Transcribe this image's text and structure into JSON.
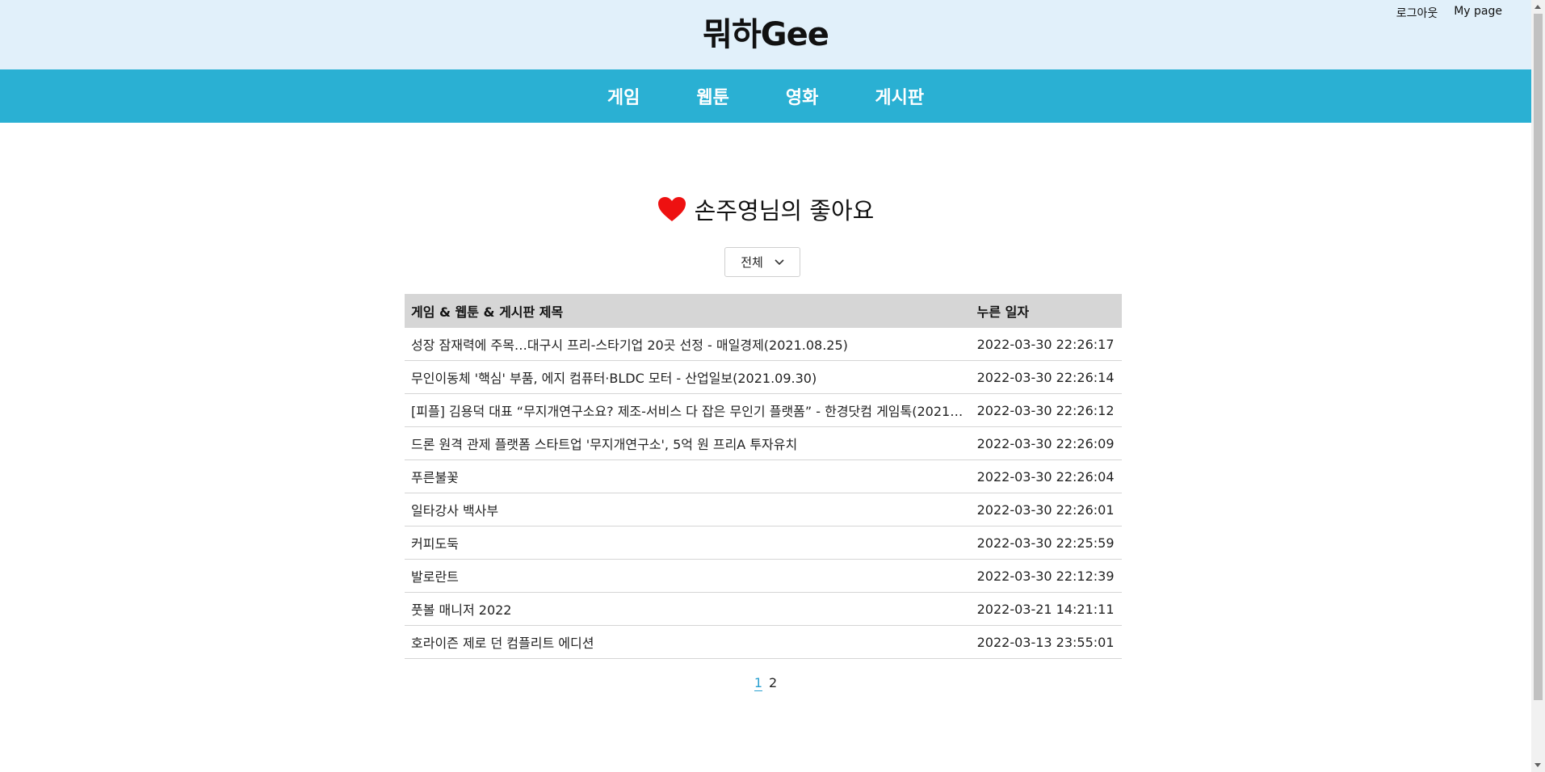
{
  "header": {
    "logo": "뭐하Gee",
    "logout_label": "로그아웃",
    "mypage_label": "My page"
  },
  "nav": {
    "items": [
      {
        "label": "게임"
      },
      {
        "label": "웹툰"
      },
      {
        "label": "영화"
      },
      {
        "label": "게시판"
      }
    ]
  },
  "main": {
    "title": "손주영님의 좋아요",
    "heart_color": "#ee1111",
    "filter": {
      "selected": "전체"
    },
    "table": {
      "headers": [
        "게임 & 웹툰 & 게시판 제목",
        "누른 일자"
      ],
      "rows": [
        {
          "title": "성장 잠재력에 주목…대구시 프리-스타기업 20곳 선정 - 매일경제(2021.08.25)",
          "date": "2022-03-30 22:26:17"
        },
        {
          "title": "무인이동체 '핵심' 부품, 에지 컴퓨터·BLDC 모터 - 산업일보(2021.09.30)",
          "date": "2022-03-30 22:26:14"
        },
        {
          "title": "[피플] 김용덕 대표 “무지개연구소요? 제조-서비스 다 잡은 무인기 플랫폼” - 한경닷컴 게임톡(2021.0…",
          "date": "2022-03-30 22:26:12"
        },
        {
          "title": "드론 원격 관제 플랫폼 스타트업 '무지개연구소', 5억 원 프리A 투자유치",
          "date": "2022-03-30 22:26:09"
        },
        {
          "title": "푸른불꽃",
          "date": "2022-03-30 22:26:04"
        },
        {
          "title": "일타강사 백사부",
          "date": "2022-03-30 22:26:01"
        },
        {
          "title": "커피도둑",
          "date": "2022-03-30 22:25:59"
        },
        {
          "title": "발로란트",
          "date": "2022-03-30 22:12:39"
        },
        {
          "title": "풋볼 매니저 2022",
          "date": "2022-03-21 14:21:11"
        },
        {
          "title": "호라이즌 제로 던 컴플리트 에디션",
          "date": "2022-03-13 23:55:01"
        }
      ]
    },
    "pagination": {
      "pages": [
        "1",
        "2"
      ],
      "active": "1"
    }
  },
  "colors": {
    "topbar": "#e1f0fa",
    "navbar": "#2ab0d3",
    "table_header": "#d6d6d6",
    "active_page": "#2aa0d0"
  }
}
